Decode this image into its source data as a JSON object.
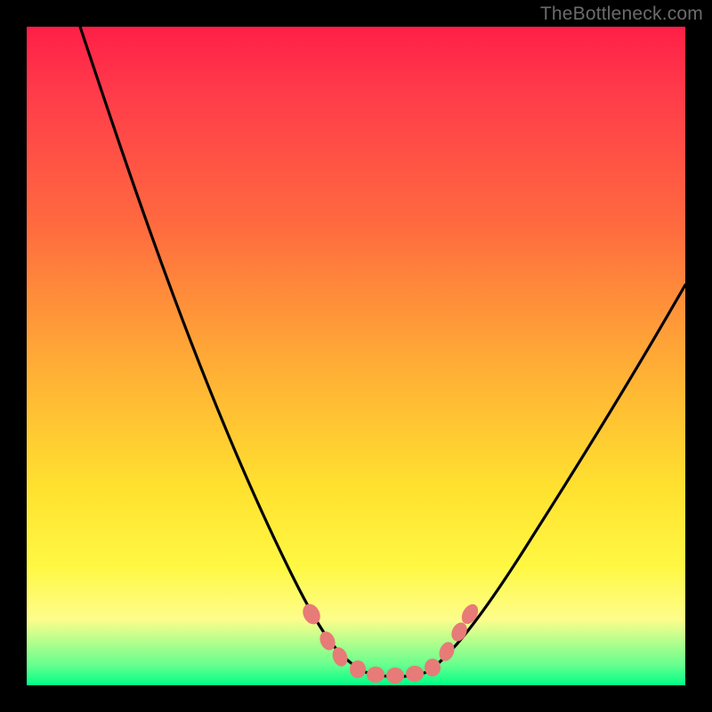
{
  "watermark_text": "TheBottleneck.com",
  "chart_data": {
    "type": "line",
    "title": "",
    "xlabel": "",
    "ylabel": "",
    "xlim": [
      0,
      100
    ],
    "ylim": [
      0,
      100
    ],
    "grid": false,
    "background_gradient": [
      "#ff1f47",
      "#ffa936",
      "#ffe12f",
      "#00ff87"
    ],
    "series": [
      {
        "name": "bottleneck-curve",
        "color": "#000000",
        "x": [
          10,
          15,
          20,
          25,
          30,
          35,
          40,
          43,
          45,
          48,
          50,
          52,
          55,
          57,
          60,
          65,
          70,
          75,
          80,
          85,
          90,
          95,
          100
        ],
        "y": [
          100,
          88,
          76,
          64,
          52,
          40,
          28,
          18,
          12,
          6,
          3,
          1,
          0,
          0,
          1,
          6,
          14,
          22,
          30,
          38,
          46,
          54,
          62
        ]
      }
    ],
    "markers": [
      {
        "name": "flat-bottom-dots",
        "color": "#e77b77",
        "points": [
          {
            "x": 43,
            "y": 10
          },
          {
            "x": 45,
            "y": 7
          },
          {
            "x": 47,
            "y": 4
          },
          {
            "x": 50,
            "y": 2
          },
          {
            "x": 53,
            "y": 1.5
          },
          {
            "x": 56,
            "y": 1.5
          },
          {
            "x": 59,
            "y": 2
          },
          {
            "x": 61,
            "y": 3.5
          },
          {
            "x": 63,
            "y": 7
          },
          {
            "x": 65,
            "y": 10
          }
        ]
      }
    ]
  }
}
